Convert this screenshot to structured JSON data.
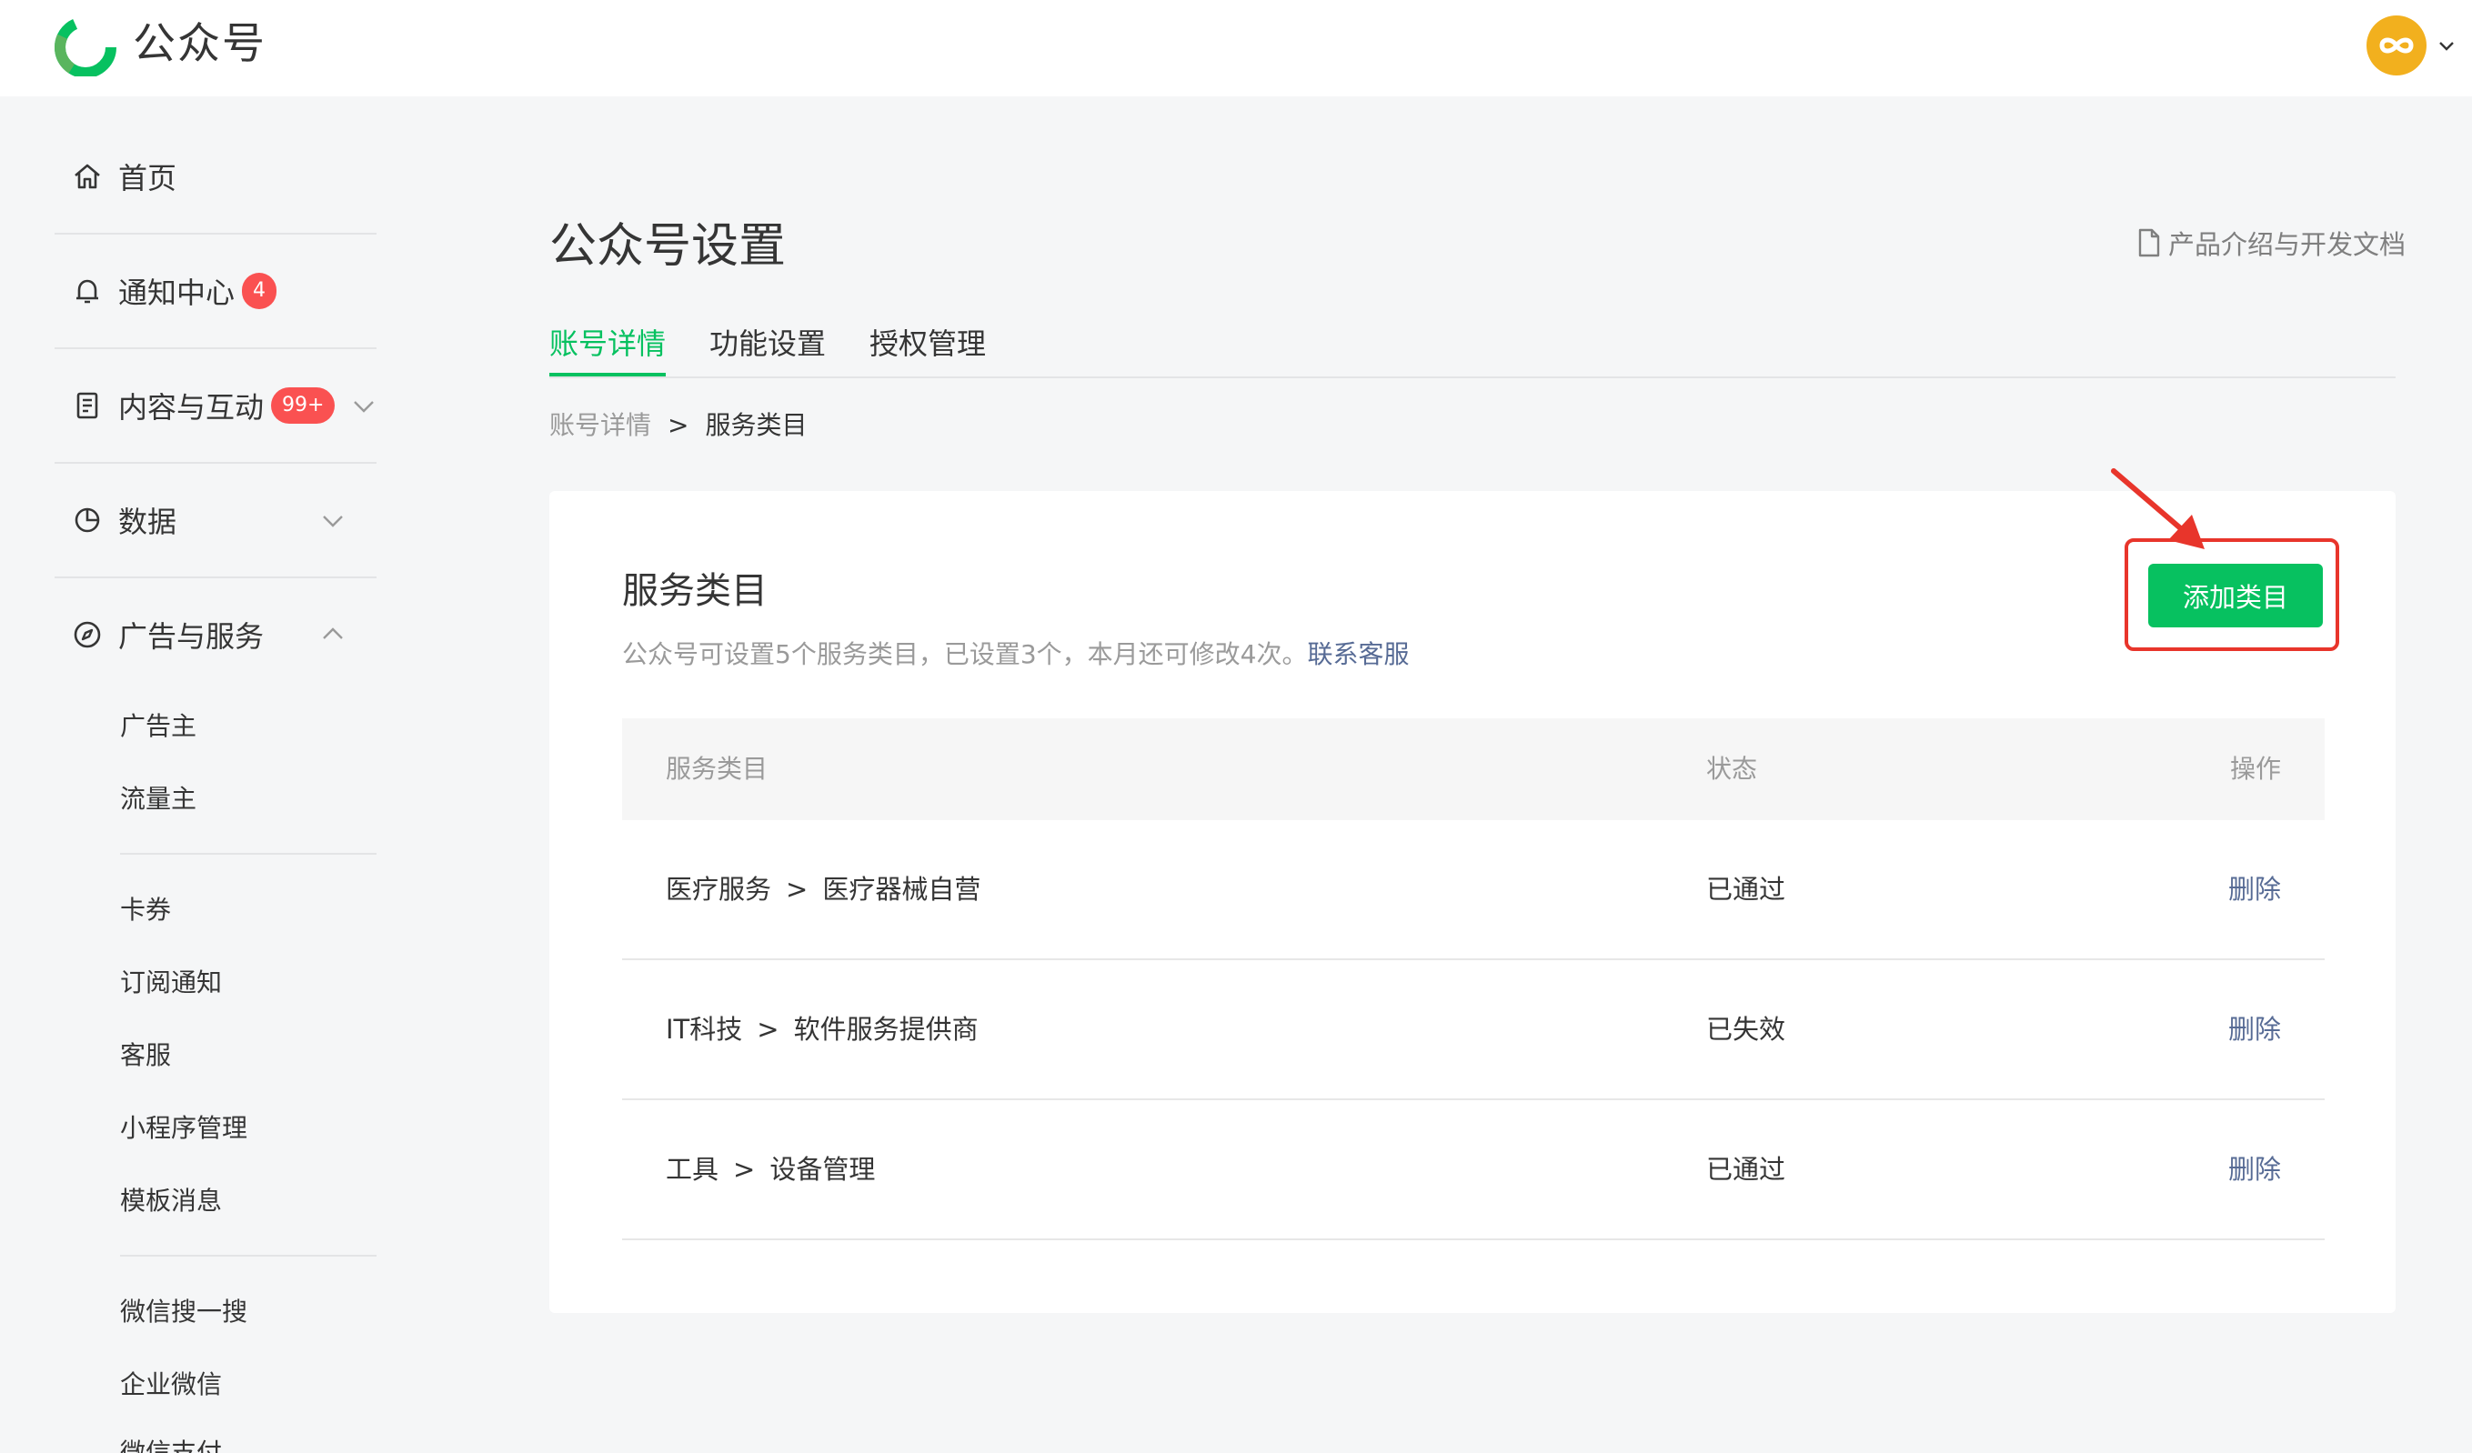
{
  "header": {
    "app_name": "公众号",
    "logo_icon": "wechat-mp-logo-icon",
    "avatar_icon": "infinity-avatar-icon",
    "accent_color": "#07c160"
  },
  "sidebar": {
    "items": [
      {
        "label": "首页",
        "icon": "home-icon"
      },
      {
        "label": "通知中心",
        "icon": "bell-icon",
        "badge": "4"
      },
      {
        "label": "内容与互动",
        "icon": "document-icon",
        "badge": "99+"
      },
      {
        "label": "数据",
        "icon": "pie-chart-icon"
      },
      {
        "label": "广告与服务",
        "icon": "compass-icon"
      }
    ],
    "sub_items": [
      "广告主",
      "流量主",
      "卡券",
      "订阅通知",
      "客服",
      "小程序管理",
      "模板消息",
      "微信搜一搜",
      "企业微信",
      "微信支付"
    ]
  },
  "main": {
    "title": "公众号设置",
    "doc_link": "产品介绍与开发文档",
    "tabs": [
      {
        "label": "账号详情",
        "active": true
      },
      {
        "label": "功能设置",
        "active": false
      },
      {
        "label": "授权管理",
        "active": false
      }
    ],
    "breadcrumb": {
      "parent": "账号详情",
      "separator": ">",
      "current": "服务类目"
    }
  },
  "card": {
    "title": "服务类目",
    "description": "公众号可设置5个服务类目，已设置3个，本月还可修改4次。",
    "contact_link": "联系客服",
    "add_button": "添加类目",
    "table": {
      "headers": [
        "服务类目",
        "状态",
        "操作"
      ],
      "rows": [
        {
          "category": "医疗服务",
          "subcategory": "医疗器械自营",
          "status": "已通过",
          "action": "删除"
        },
        {
          "category": "IT科技",
          "subcategory": "软件服务提供商",
          "status": "已失效",
          "action": "删除"
        },
        {
          "category": "工具",
          "subcategory": "设备管理",
          "status": "已通过",
          "action": "删除"
        }
      ],
      "separator": ">"
    }
  }
}
